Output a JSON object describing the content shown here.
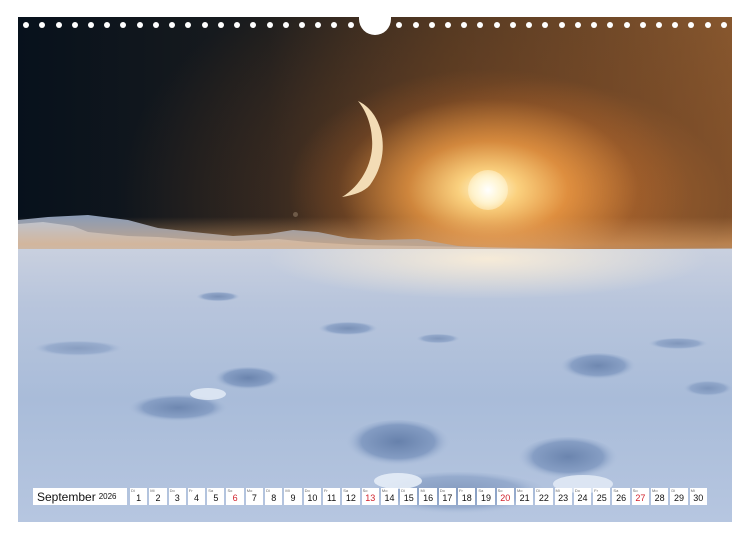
{
  "calendar": {
    "month": "September",
    "year": "2026",
    "days": [
      {
        "num": "1",
        "weekday": "Di",
        "sunday": false
      },
      {
        "num": "2",
        "weekday": "Mi",
        "sunday": false
      },
      {
        "num": "3",
        "weekday": "Do",
        "sunday": false
      },
      {
        "num": "4",
        "weekday": "Fr",
        "sunday": false
      },
      {
        "num": "5",
        "weekday": "Sa",
        "sunday": false
      },
      {
        "num": "6",
        "weekday": "So",
        "sunday": true
      },
      {
        "num": "7",
        "weekday": "Mo",
        "sunday": false
      },
      {
        "num": "8",
        "weekday": "Di",
        "sunday": false
      },
      {
        "num": "9",
        "weekday": "Mi",
        "sunday": false
      },
      {
        "num": "10",
        "weekday": "Do",
        "sunday": false
      },
      {
        "num": "11",
        "weekday": "Fr",
        "sunday": false
      },
      {
        "num": "12",
        "weekday": "Sa",
        "sunday": false
      },
      {
        "num": "13",
        "weekday": "So",
        "sunday": true
      },
      {
        "num": "14",
        "weekday": "Mo",
        "sunday": false
      },
      {
        "num": "15",
        "weekday": "Di",
        "sunday": false
      },
      {
        "num": "16",
        "weekday": "Mi",
        "sunday": false
      },
      {
        "num": "17",
        "weekday": "Do",
        "sunday": false
      },
      {
        "num": "18",
        "weekday": "Fr",
        "sunday": false
      },
      {
        "num": "19",
        "weekday": "Sa",
        "sunday": false
      },
      {
        "num": "20",
        "weekday": "So",
        "sunday": true
      },
      {
        "num": "21",
        "weekday": "Mo",
        "sunday": false
      },
      {
        "num": "22",
        "weekday": "Di",
        "sunday": false
      },
      {
        "num": "23",
        "weekday": "Mi",
        "sunday": false
      },
      {
        "num": "24",
        "weekday": "Do",
        "sunday": false
      },
      {
        "num": "25",
        "weekday": "Fr",
        "sunday": false
      },
      {
        "num": "26",
        "weekday": "Sa",
        "sunday": false
      },
      {
        "num": "27",
        "weekday": "So",
        "sunday": true
      },
      {
        "num": "28",
        "weekday": "Mo",
        "sunday": false
      },
      {
        "num": "29",
        "weekday": "Di",
        "sunday": false
      },
      {
        "num": "30",
        "weekday": "Mi",
        "sunday": false
      }
    ]
  },
  "colors": {
    "sunday_red": "#d0202a",
    "cell_background": "#ffffff",
    "text": "#111111"
  }
}
